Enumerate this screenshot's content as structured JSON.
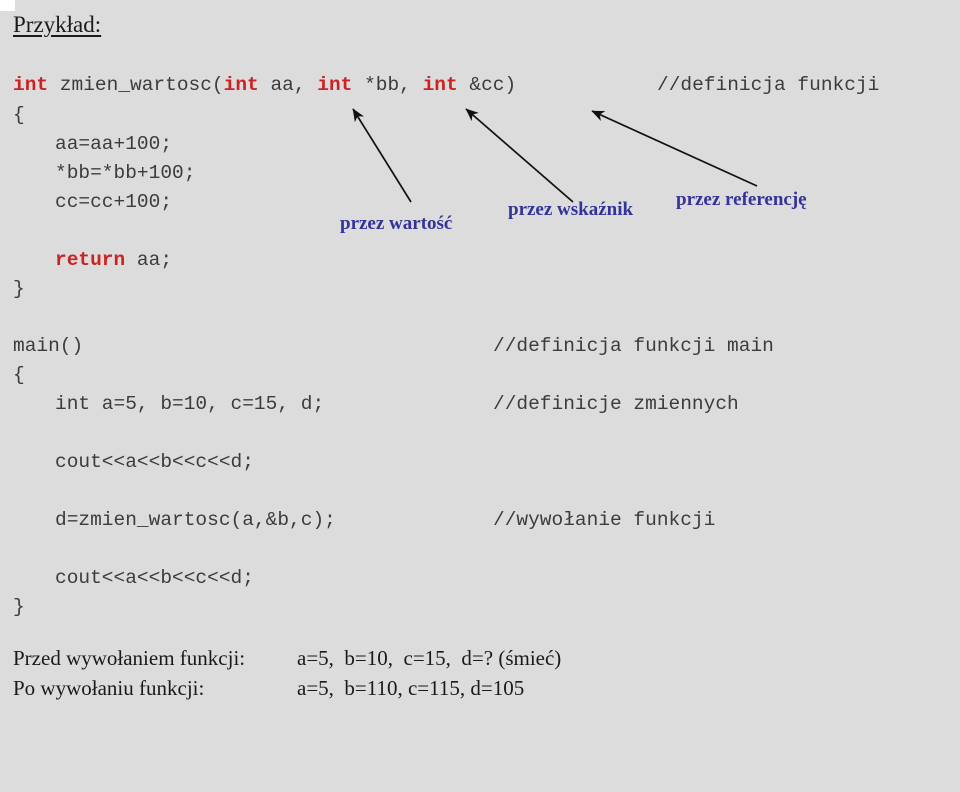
{
  "slide": {
    "title": "Przykład:",
    "background_color": "#dcdcdc",
    "keyword_color": "#cc2222",
    "annotation_color": "#333399",
    "code_color": "#3c3c3c"
  },
  "code": {
    "function_def": {
      "line1_kw": "int",
      "line1_a": " zmien_wartosc(",
      "line1_kw2": "int",
      "line1_b": " aa, ",
      "line1_kw3": "int",
      "line1_c": " *bb, ",
      "line1_kw4": "int",
      "line1_d": " &cc)",
      "line1_comment": "//definicja funkcji",
      "open_brace": "{",
      "stmt1": "aa=aa+100;",
      "stmt2": "*bb=*bb+100;",
      "stmt3": "cc=cc+100;",
      "return_kw": "return",
      "return_expr": " aa;",
      "close_brace": "}"
    },
    "main_def": {
      "header": "main()",
      "header_comment": "//definicja funkcji main",
      "open_brace": "{",
      "vars": "int a=5, b=10, c=15, d;",
      "vars_comment": "//definicje zmiennych",
      "cout1": "cout<<a<<b<<c<<d;",
      "call": "d=zmien_wartosc(a,&b,c);",
      "call_comment": "//wywołanie funkcji",
      "cout2": "cout<<a<<b<<c<<d;",
      "close_brace": "}"
    }
  },
  "annotations": [
    {
      "label": "przez wartość"
    },
    {
      "label": "przez wskaźnik"
    },
    {
      "label": "przez referencję"
    }
  ],
  "summary": {
    "before_label": "Przed wywołaniem funkcji:",
    "before_values": "a=5,  b=10,  c=15,  d=? (śmieć)",
    "after_label": "Po wywołaniu funkcji:",
    "after_values": "a=5,  b=110, c=115, d=105"
  }
}
